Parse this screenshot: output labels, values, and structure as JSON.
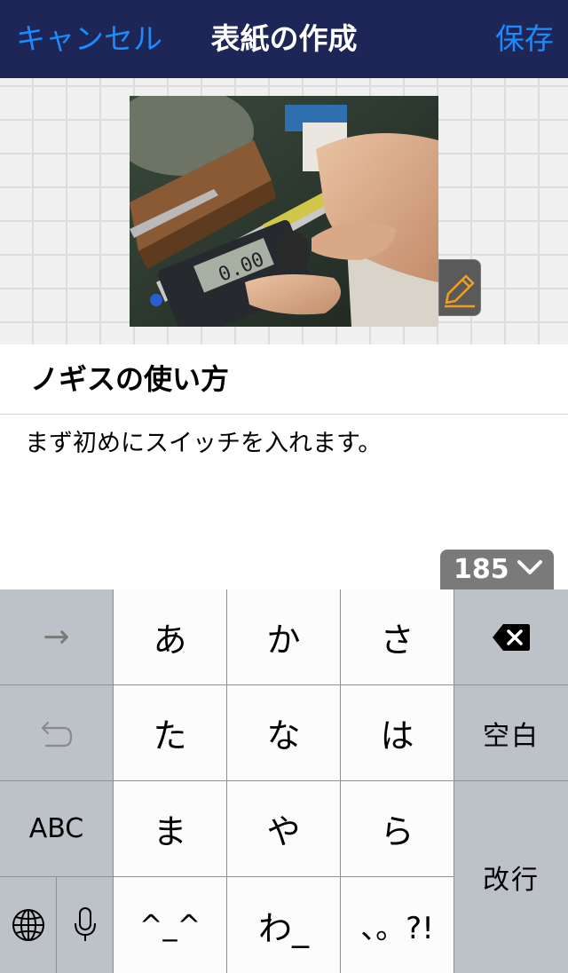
{
  "nav": {
    "cancel": "キャンセル",
    "title": "表紙の作成",
    "save": "保存",
    "accent_color": "#1a8cff",
    "bar_color": "#1e2557"
  },
  "cover": {
    "edit_icon": "pencil-icon"
  },
  "title": "ノギスの使い方",
  "body": "まず初めにスイッチを入れます。",
  "counter": {
    "value": "185",
    "icon": "chevron-down-icon"
  },
  "keyboard": {
    "row1": {
      "left": "→",
      "k1": "あ",
      "k2": "か",
      "k3": "さ",
      "right_icon": "backspace-icon"
    },
    "row2": {
      "left_icon": "undo-icon",
      "k1": "た",
      "k2": "な",
      "k3": "は",
      "right": "空白"
    },
    "row3": {
      "left": "ABC",
      "k1": "ま",
      "k2": "や",
      "k3": "ら",
      "right": "改行"
    },
    "row4": {
      "globe_icon": "globe-icon",
      "mic_icon": "microphone-icon",
      "k1": "^_^",
      "k2": "わ_",
      "k3": "、。?!"
    }
  }
}
